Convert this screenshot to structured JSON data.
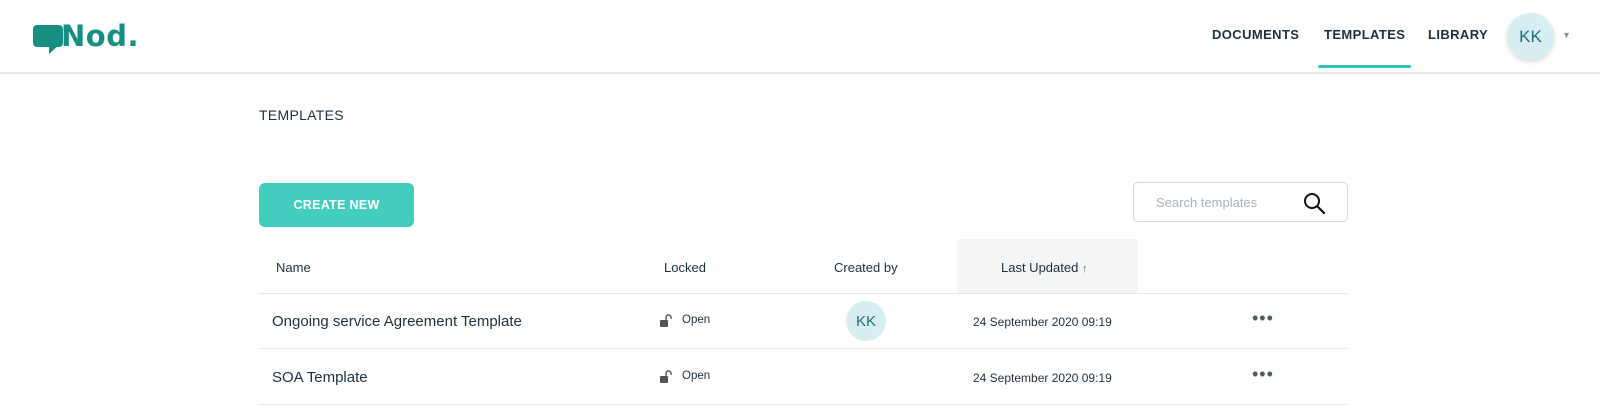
{
  "app": {
    "logo_text": "Nod."
  },
  "nav": {
    "items": [
      {
        "label": "DOCUMENTS",
        "active": false
      },
      {
        "label": "TEMPLATES",
        "active": true
      },
      {
        "label": "LIBRARY",
        "active": false
      }
    ],
    "user_initials": "KK",
    "accent_color": "#2ec4b6"
  },
  "page": {
    "title": "TEMPLATES",
    "create_button_label": "CREATE NEW",
    "search_placeholder": "Search templates"
  },
  "table": {
    "columns": [
      {
        "label": "Name"
      },
      {
        "label": "Locked"
      },
      {
        "label": "Created by"
      },
      {
        "label": "Last Updated",
        "sort_indicator": "↑"
      }
    ],
    "rows": [
      {
        "name": "Ongoing service Agreement Template",
        "locked_status": "Open",
        "created_by": "KK",
        "last_updated": "24 September 2020 09:19"
      },
      {
        "name": "SOA Template",
        "locked_status": "Open",
        "created_by": "",
        "last_updated": "24 September 2020 09:19"
      }
    ]
  },
  "colors": {
    "brand": "#148f82",
    "button": "#43cdbd",
    "avatar_bg": "#d6eef0"
  }
}
